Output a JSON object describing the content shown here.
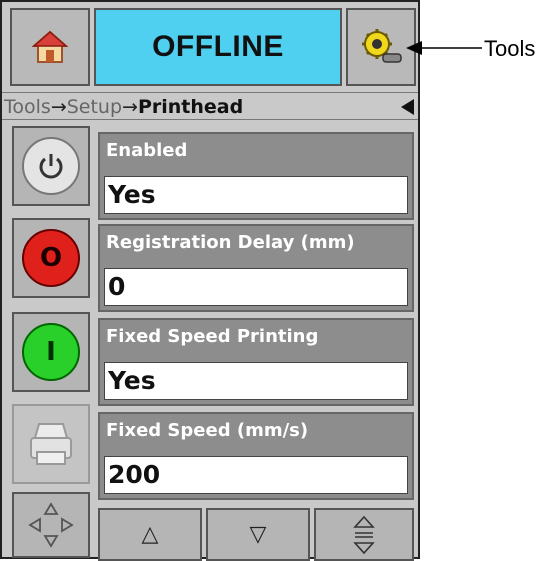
{
  "header": {
    "status": "OFFLINE",
    "home_icon": "home-icon",
    "tools_icon": "tools-gear-icon"
  },
  "breadcrumb": {
    "item1": "Tools",
    "item2": "Setup",
    "current": "Printhead",
    "separator": "→"
  },
  "side_buttons": {
    "power_icon": "power-icon",
    "stop_label": "O",
    "start_label": "I",
    "printer_icon": "printer-icon",
    "nav_icon": "navigate-arrows-icon"
  },
  "fields": [
    {
      "label": "Enabled",
      "value": "Yes"
    },
    {
      "label": "Registration Delay (mm)",
      "value": "0"
    },
    {
      "label": "Fixed Speed Printing",
      "value": "Yes"
    },
    {
      "label": "Fixed Speed (mm/s)",
      "value": "200"
    }
  ],
  "bottom": {
    "up": "△",
    "down": "▽",
    "updown_icon": "up-down-arrows-icon"
  },
  "annotation": "Tools",
  "colors": {
    "status_bg": "#4fd0f0",
    "stop": "#e0201a",
    "start": "#2ad02a"
  }
}
